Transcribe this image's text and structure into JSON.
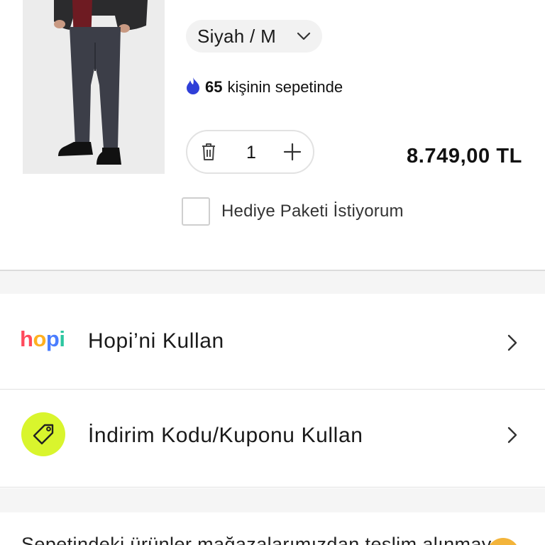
{
  "product": {
    "image_alt": "product-photo",
    "variant": "Siyah / M",
    "basket_count": "65",
    "basket_text": "kişinin sepetinde",
    "quantity": "1",
    "price": "8.749,00 TL",
    "gift_label": "Hediye Paketi İstiyorum",
    "gift_checked": false
  },
  "options": {
    "hopi": {
      "logo": "hopi",
      "label": "Hopi’ni Kullan"
    },
    "coupon": {
      "label": "İndirim Kodu/Kuponu Kullan"
    }
  },
  "info": {
    "text": "Sepetindeki ürünler mağazalarımızdan teslim alınmaya"
  },
  "colors": {
    "accent_fire": "#2f3fd8",
    "coupon_badge": "#d9f52d",
    "hopi_h": "#ff4a5c",
    "hopi_o": "#ffb020",
    "hopi_p": "#4a7dff",
    "hopi_i": "#2cc6a0"
  },
  "icons": {
    "variant": "chevron-down-icon",
    "basket": "fire-icon",
    "delete": "trash-icon",
    "increase": "plus-icon",
    "coupon": "tag-icon",
    "row": "chevron-right-icon"
  }
}
